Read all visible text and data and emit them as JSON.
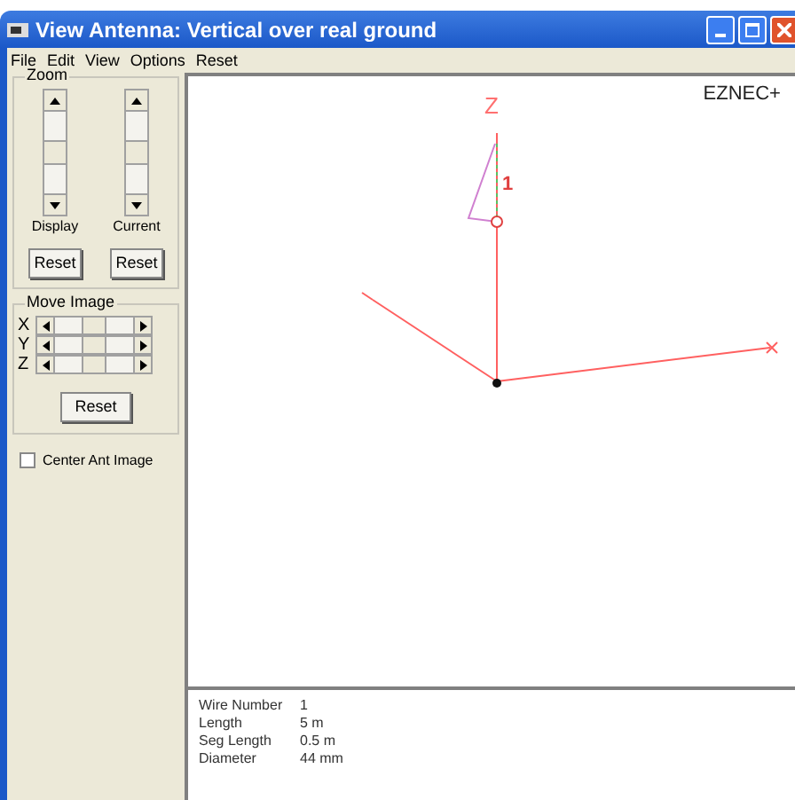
{
  "window": {
    "title": "View Antenna: Vertical over real ground"
  },
  "menu": [
    "File",
    "Edit",
    "View",
    "Options",
    "Reset"
  ],
  "zoom": {
    "title": "Zoom",
    "sliders": [
      {
        "label": "Display",
        "button": "Reset"
      },
      {
        "label": "Current",
        "button": "Reset"
      }
    ]
  },
  "move_image": {
    "title": "Move Image",
    "axes": [
      "X",
      "Y",
      "Z"
    ],
    "button": "Reset"
  },
  "center_ant_image": {
    "label": "Center Ant Image",
    "checked": false
  },
  "canvas": {
    "brand": "EZNEC+",
    "axis_label": "Z",
    "wire_label": "1"
  },
  "wire_info": [
    {
      "label": "Wire Number",
      "value": "1"
    },
    {
      "label": "Length",
      "value": "5 m"
    },
    {
      "label": "Seg Length",
      "value": "0.5 m"
    },
    {
      "label": "Diameter",
      "value": "44 mm"
    }
  ]
}
